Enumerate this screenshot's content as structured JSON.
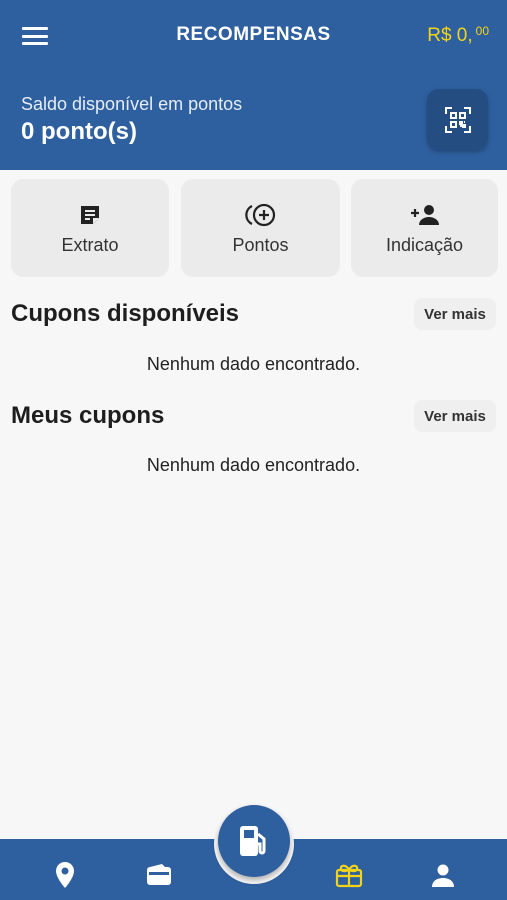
{
  "header": {
    "title": "RECOMPENSAS",
    "balance_main": "R$ 0,",
    "balance_cents": "00",
    "saldo_label": "Saldo disponível em pontos",
    "saldo_value": "0 ponto(s)"
  },
  "actions": [
    {
      "label": "Extrato",
      "icon": "note-icon"
    },
    {
      "label": "Pontos",
      "icon": "add-coin-icon"
    },
    {
      "label": "Indicação",
      "icon": "add-person-icon"
    }
  ],
  "sections": {
    "cupons_disponiveis": {
      "title": "Cupons disponíveis",
      "more": "Ver mais",
      "empty": "Nenhum dado encontrado."
    },
    "meus_cupons": {
      "title": "Meus cupons",
      "more": "Ver mais",
      "empty": "Nenhum dado encontrado."
    }
  },
  "nav": [
    "location-pin-icon",
    "wallet-icon",
    "fuel-pump-icon",
    "gift-icon",
    "person-icon"
  ],
  "colors": {
    "primary": "#2e5f9e",
    "accent": "#f2d31b",
    "background": "#f7f7f7"
  }
}
